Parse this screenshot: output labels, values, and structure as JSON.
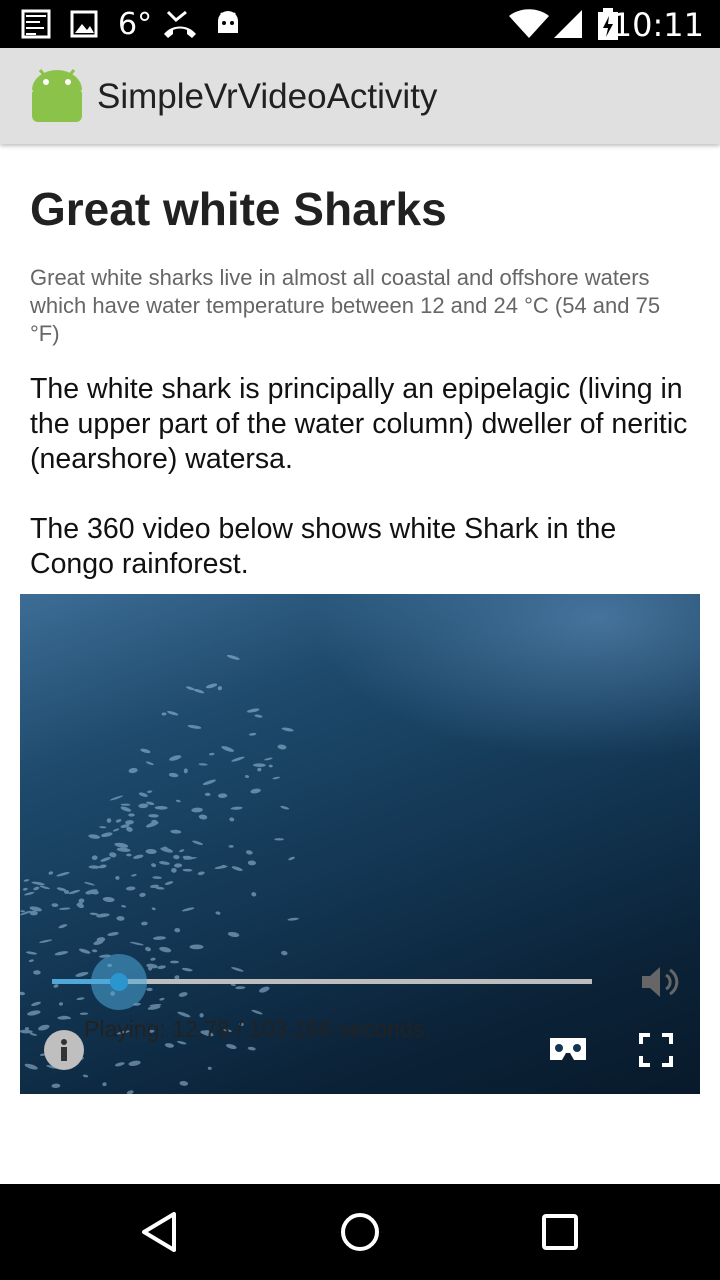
{
  "status_bar": {
    "icons": [
      "screenshot-icon",
      "image-icon",
      "missed-call-icon",
      "android-debug-icon",
      "wifi-icon",
      "signal-icon",
      "battery-icon"
    ],
    "temperature": "6°",
    "time": "10:11"
  },
  "app_bar": {
    "logo": "android-logo-icon",
    "title": "SimpleVrVideoActivity"
  },
  "article": {
    "heading": "Great white Sharks",
    "subtext": "Great white sharks live in almost all coastal and offshore waters which have water temperature between 12 and 24 °C (54 and 75 °F)",
    "paragraph_1": "The white shark is principally an epipelagic (living in the upper part of the water column) dweller of neritic (nearshore) watersa.",
    "paragraph_2": "The 360 video below shows white Shark in the Congo rainforest."
  },
  "video": {
    "controls": [
      "info-icon",
      "cardboard-vr-icon",
      "fullscreen-icon"
    ]
  },
  "playback": {
    "progress_fraction": 0.124,
    "status_text": "Playing: 12.78 / 103.166 seconds.",
    "volume_icon": "volume-icon",
    "accent_color": "#4fa8d8"
  },
  "nav_bar": {
    "buttons": [
      "back-icon",
      "home-icon",
      "recents-icon"
    ]
  }
}
